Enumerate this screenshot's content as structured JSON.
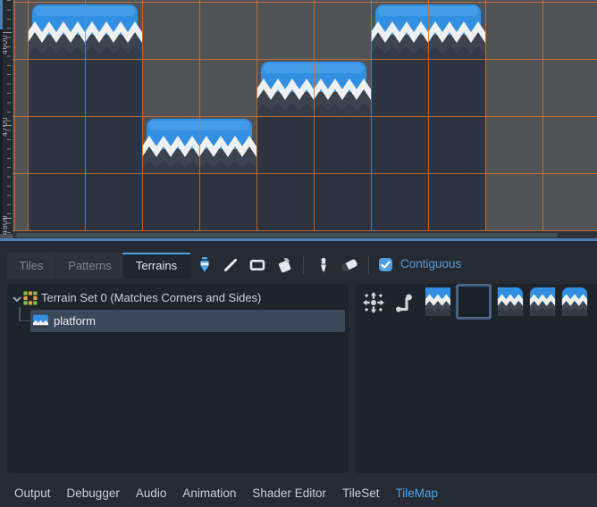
{
  "viewport": {
    "ruler": {
      "labels": [
        "4600",
        "4700",
        "4800"
      ]
    },
    "grid_color": "#d27032",
    "background_color": "#515457",
    "dirt_color": "#2f3540",
    "platform_blue": "#3190e1"
  },
  "tabs": {
    "tiles": "Tiles",
    "patterns": "Patterns",
    "terrains": "Terrains",
    "active": "Terrains"
  },
  "toolbar": {
    "icons": [
      "paint-icon",
      "line-icon",
      "rect-icon",
      "bucket-fill-icon",
      "picker-icon",
      "eraser-icon"
    ],
    "selected_tool": "paint",
    "contiguous_label": "Contiguous",
    "contiguous_checked": true,
    "accent_color": "#4aa0e4"
  },
  "terrains_panel": {
    "set_label": "Terrain Set 0 (Matches Corners and Sides)",
    "terrain_label": "platform",
    "modes": [
      "connect-mode-icon",
      "path-mode-icon"
    ],
    "tiles": [
      "platform-top",
      "empty-selected",
      "platform-right-cap",
      "platform-left-cap",
      "platform-single-cap"
    ],
    "selection_color": "#3b4859"
  },
  "bottom_bar": {
    "items": [
      {
        "label": "Output",
        "active": false
      },
      {
        "label": "Debugger",
        "active": false
      },
      {
        "label": "Audio",
        "active": false
      },
      {
        "label": "Animation",
        "active": false
      },
      {
        "label": "Shader Editor",
        "active": false
      },
      {
        "label": "TileSet",
        "active": false
      },
      {
        "label": "TileMap",
        "active": true
      }
    ]
  }
}
